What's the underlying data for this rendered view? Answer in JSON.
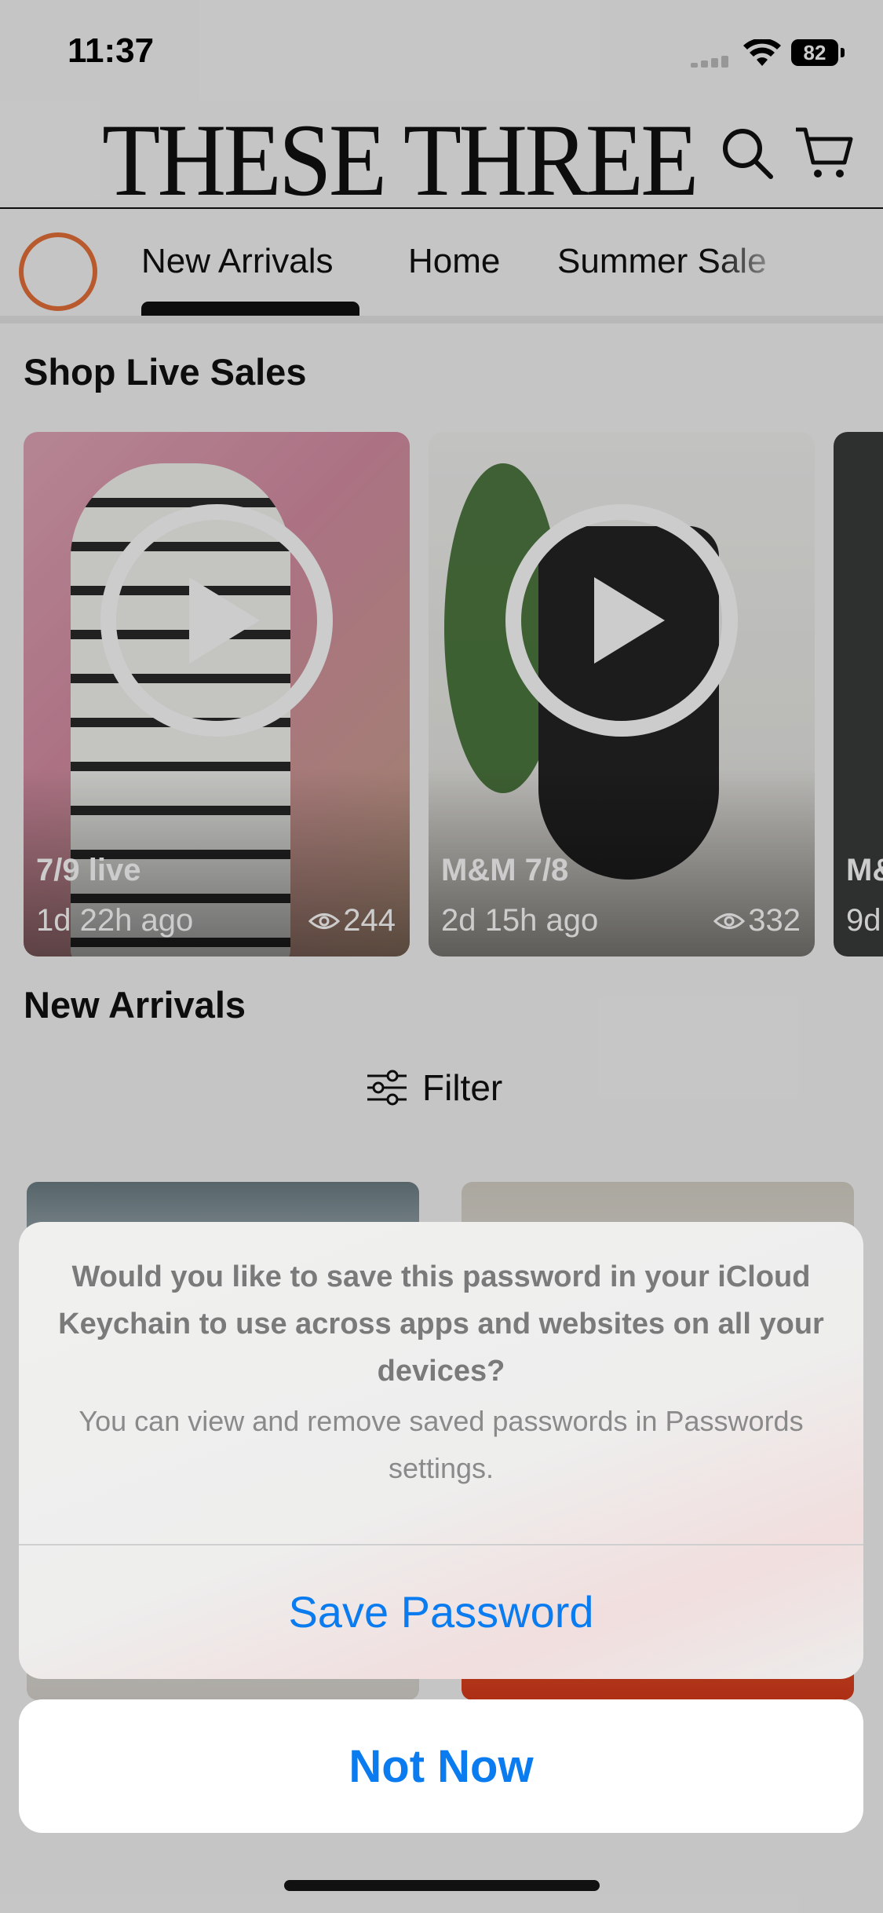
{
  "status_bar": {
    "time": "11:37",
    "battery": "82"
  },
  "header": {
    "brand": "THESE THREE"
  },
  "nav": {
    "items": [
      "New Arrivals",
      "Home",
      "Summer Sale"
    ],
    "active": "New Arrivals"
  },
  "live_sales": {
    "title": "Shop Live Sales",
    "cards": [
      {
        "title": "7/9 live",
        "ago": "1d 22h ago",
        "views": "244"
      },
      {
        "title": "M&M 7/8",
        "ago": "2d 15h ago",
        "views": "332"
      },
      {
        "title": "M&",
        "ago": "9d",
        "views": ""
      }
    ]
  },
  "new_arrivals": {
    "title": "New Arrivals",
    "filter_label": "Filter"
  },
  "alert": {
    "message": "Would you like to save this password in your iCloud Keychain to use across apps and websites on all your devices?",
    "submessage": "You can view and remove saved passwords in Passwords settings.",
    "save_label": "Save Password",
    "cancel_label": "Not Now"
  },
  "colors": {
    "accent_blue": "#0a7cf0",
    "story_ring": "#e8713a"
  }
}
